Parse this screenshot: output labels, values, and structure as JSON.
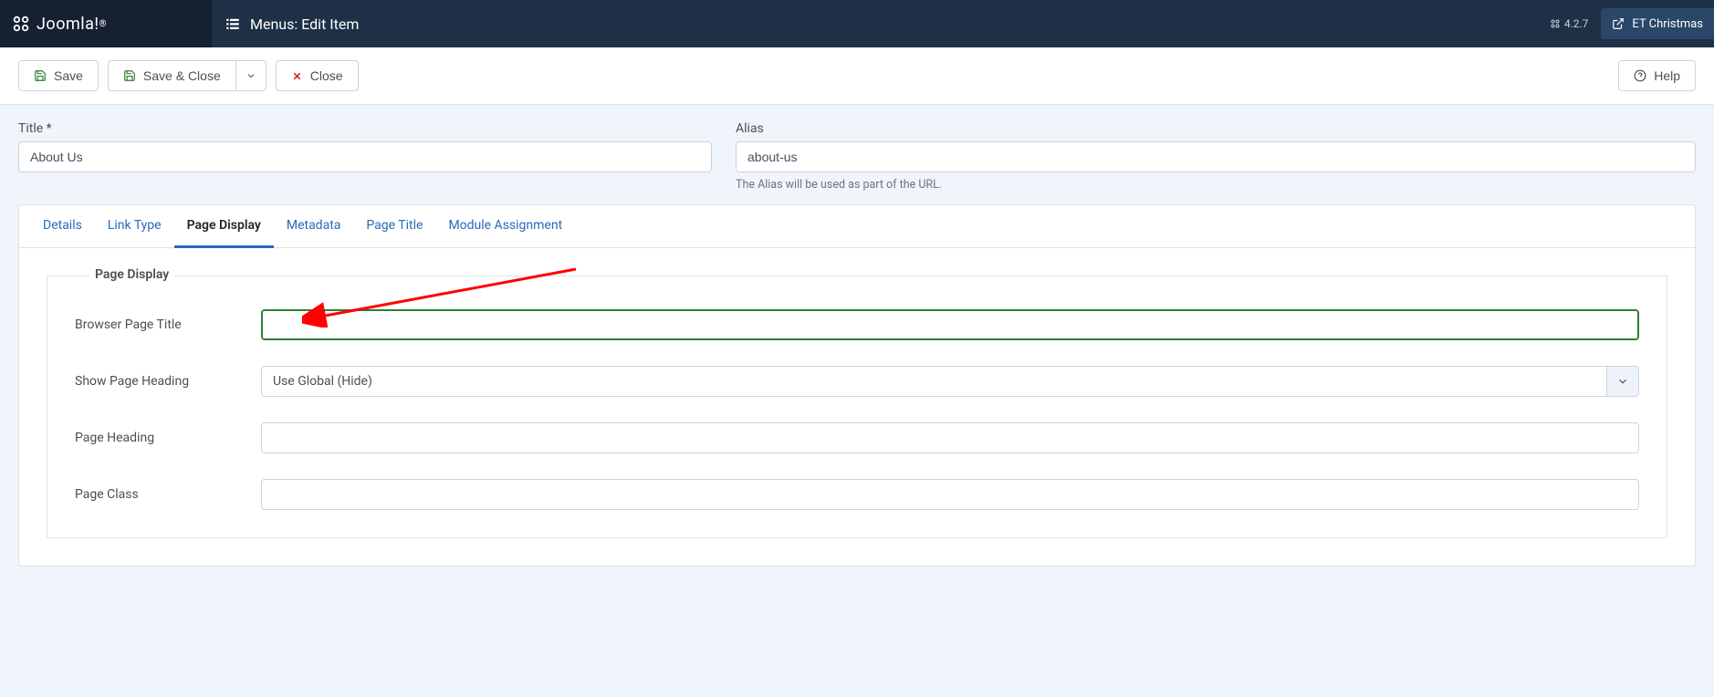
{
  "header": {
    "brand": "Joomla!",
    "page_title": "Menus: Edit Item",
    "version": "4.2.7",
    "site_name": "ET Christmas"
  },
  "toolbar": {
    "save": "Save",
    "save_close": "Save & Close",
    "close": "Close",
    "help": "Help"
  },
  "form": {
    "title_label": "Title *",
    "title_value": "About Us",
    "alias_label": "Alias",
    "alias_value": "about-us",
    "alias_hint": "The Alias will be used as part of the URL."
  },
  "tabs": [
    {
      "label": "Details"
    },
    {
      "label": "Link Type"
    },
    {
      "label": "Page Display"
    },
    {
      "label": "Metadata"
    },
    {
      "label": "Page Title"
    },
    {
      "label": "Module Assignment"
    }
  ],
  "page_display": {
    "legend": "Page Display",
    "browser_page_title_label": "Browser Page Title",
    "browser_page_title_value": "",
    "show_page_heading_label": "Show Page Heading",
    "show_page_heading_value": "Use Global (Hide)",
    "page_heading_label": "Page Heading",
    "page_heading_value": "",
    "page_class_label": "Page Class",
    "page_class_value": ""
  }
}
